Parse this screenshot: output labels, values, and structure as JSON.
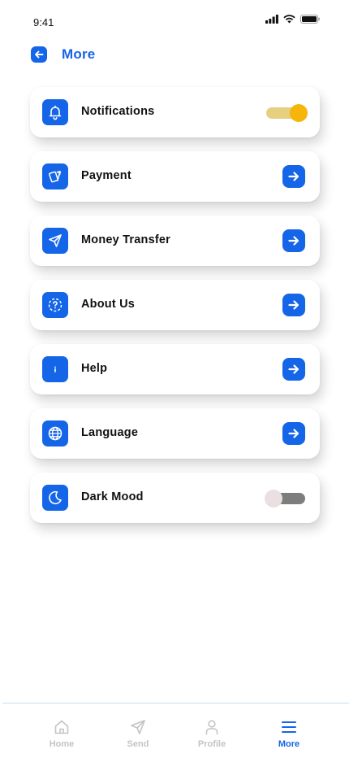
{
  "status_bar": {
    "time": "9:41"
  },
  "header": {
    "title": "More"
  },
  "menu": [
    {
      "label": "Notifications",
      "control": "toggle",
      "toggle_on": true,
      "icon": "bell-icon"
    },
    {
      "label": "Payment",
      "control": "arrow",
      "icon": "cards-icon"
    },
    {
      "label": "Money Transfer",
      "control": "arrow",
      "icon": "send-icon"
    },
    {
      "label": "About Us",
      "control": "arrow",
      "icon": "question-circle-icon"
    },
    {
      "label": "Help",
      "control": "arrow",
      "icon": "info-icon"
    },
    {
      "label": "Language",
      "control": "arrow",
      "icon": "globe-icon"
    },
    {
      "label": "Dark Mood",
      "control": "toggle",
      "toggle_on": false,
      "icon": "moon-icon"
    }
  ],
  "bottom_nav": [
    {
      "label": "Home",
      "icon": "home-icon",
      "active": false
    },
    {
      "label": "Send",
      "icon": "send-icon",
      "active": false
    },
    {
      "label": "Profile",
      "icon": "user-icon",
      "active": false
    },
    {
      "label": "More",
      "icon": "menu-icon",
      "active": true
    }
  ],
  "colors": {
    "accent": "#1565e8",
    "toggle_on_track": "#e6cf7f",
    "toggle_on_knob": "#f5b50a",
    "toggle_off_track": "#7d7d7d",
    "nav_inactive": "#c4c4c4"
  }
}
